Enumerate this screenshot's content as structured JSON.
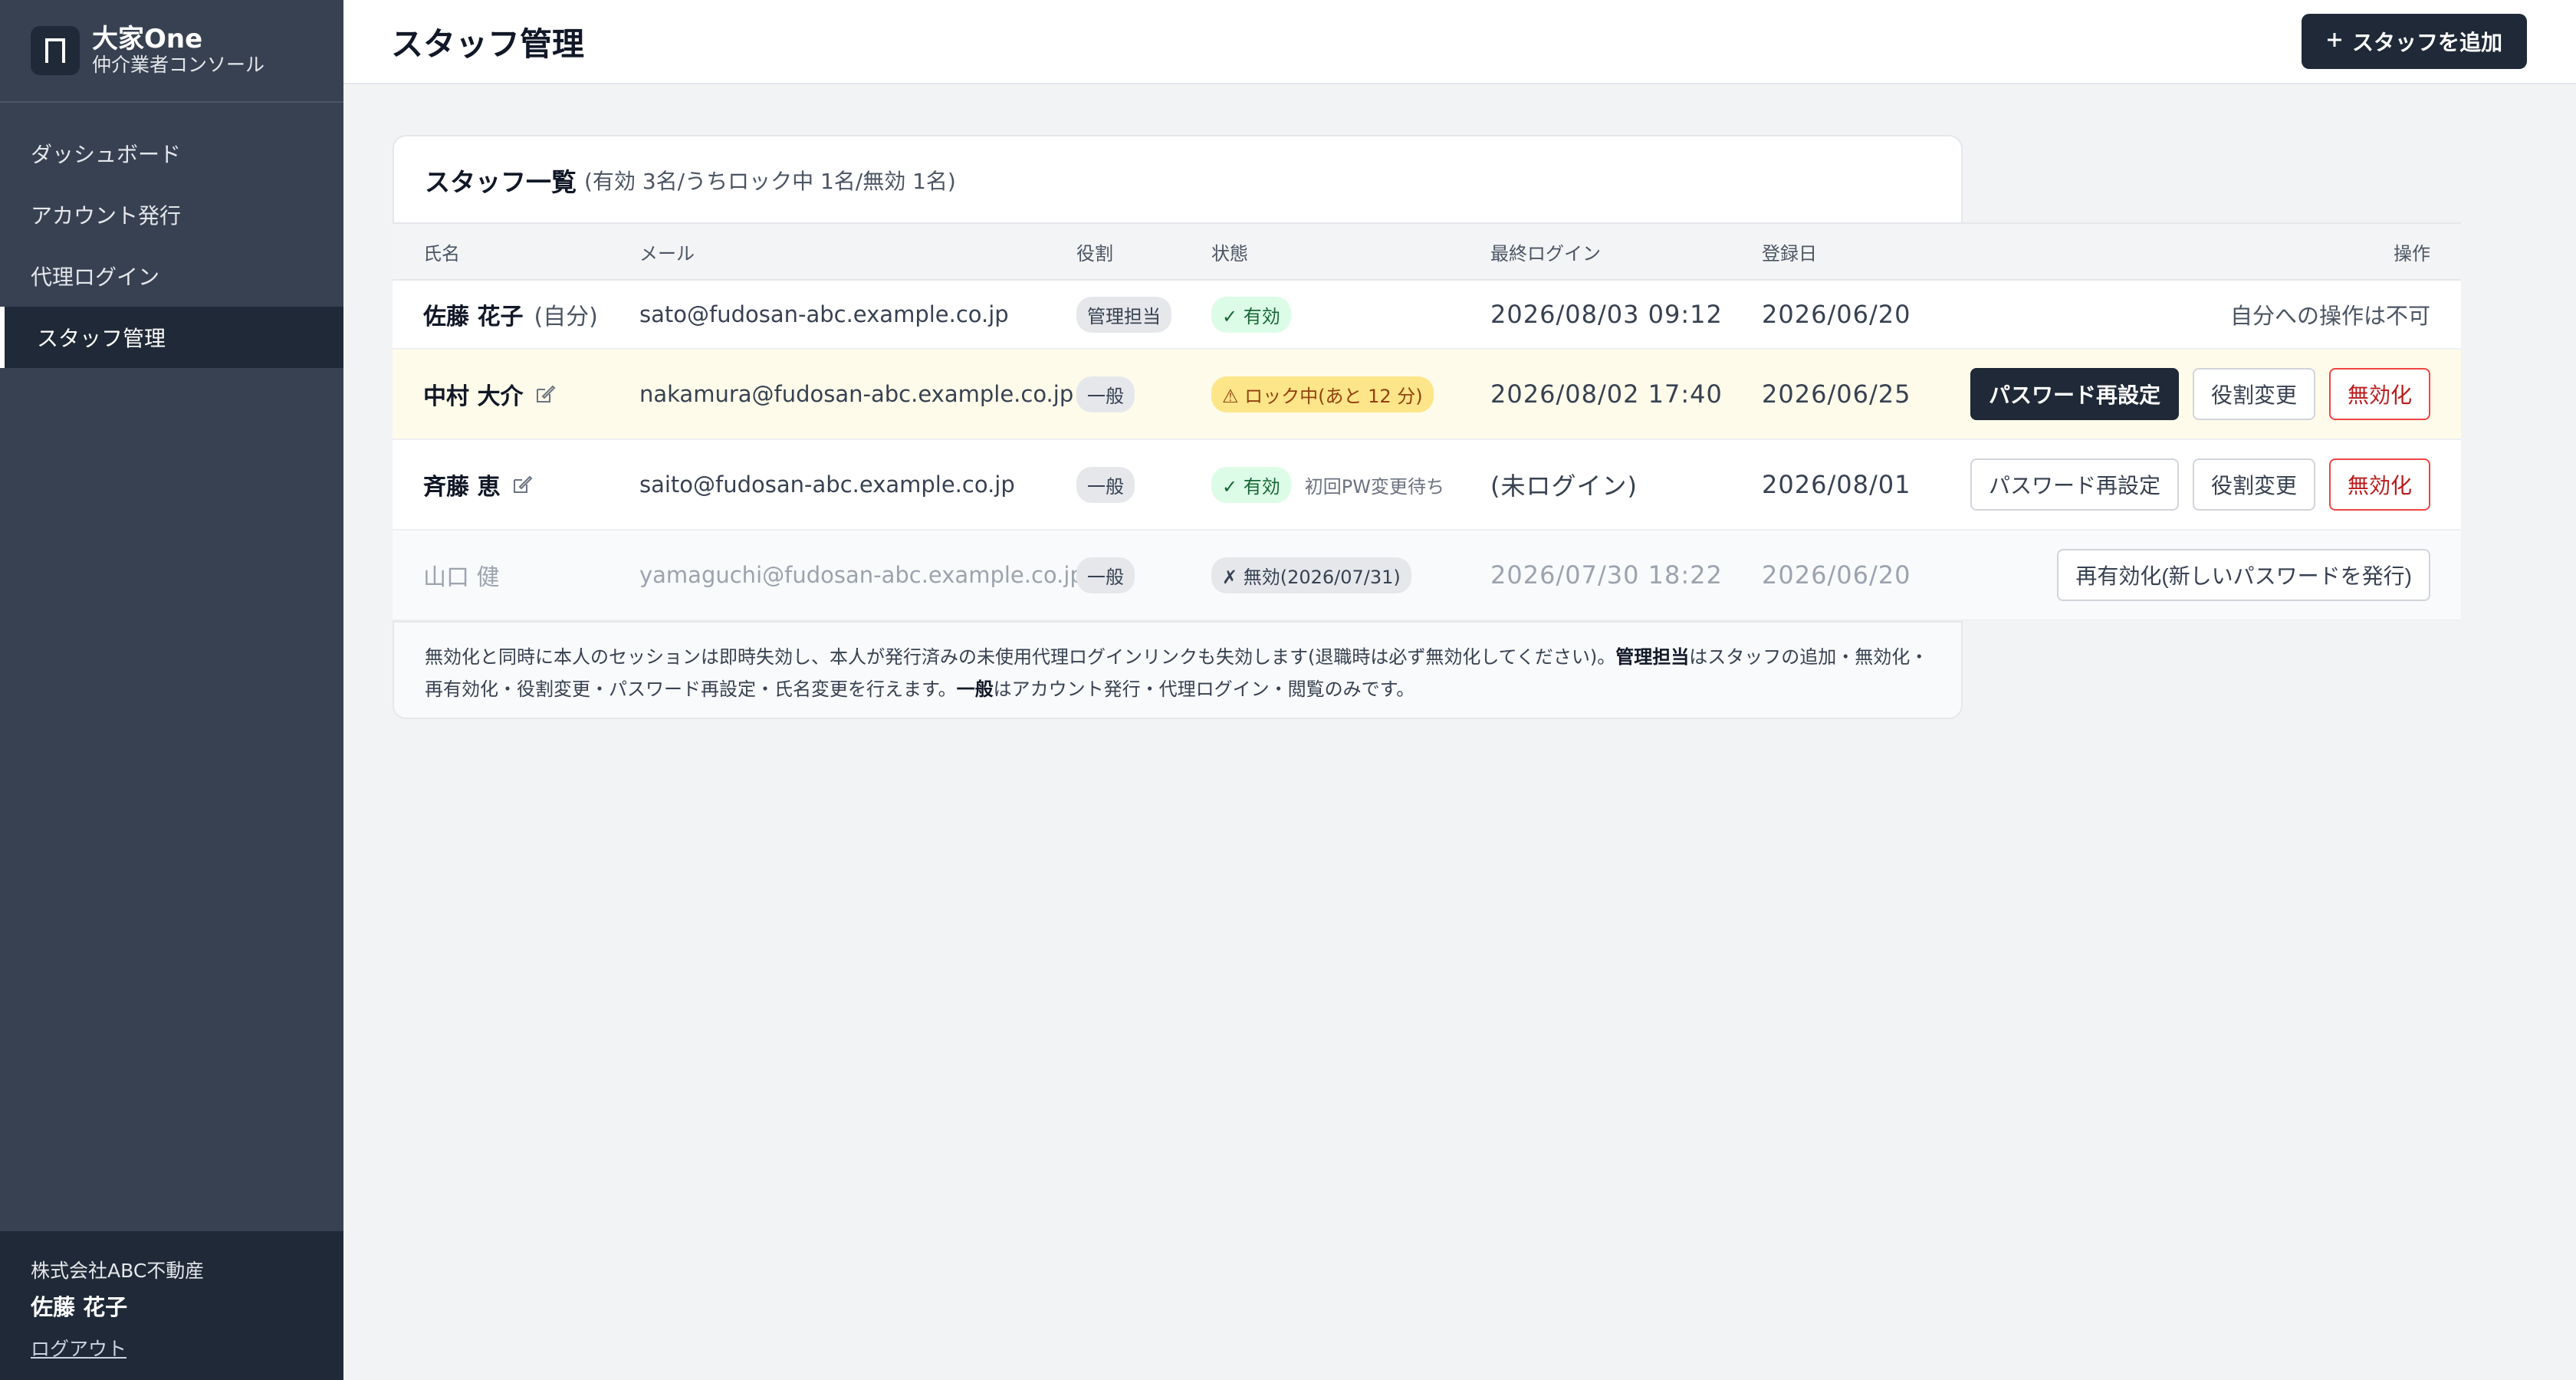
{
  "brand": {
    "name": "大家One",
    "subtitle": "仲介業者コンソール"
  },
  "nav": {
    "items": [
      "ダッシュボード",
      "アカウント発行",
      "代理ログイン",
      "スタッフ管理"
    ],
    "active": "スタッフ管理"
  },
  "footer": {
    "company": "株式会社ABC不動産",
    "user": "佐藤 花子",
    "logout": "ログアウト"
  },
  "header": {
    "title": "スタッフ管理",
    "add_button": "スタッフを追加",
    "add_icon": "plus-icon"
  },
  "card": {
    "title": "スタッフ一覧",
    "summary": "(有効 3名/うちロック中 1名/無効 1名)",
    "columns": {
      "name": "氏名",
      "mail": "メール",
      "role": "役割",
      "status": "状態",
      "login": "最終ログイン",
      "reg": "登録日",
      "ops": "操作"
    },
    "rows": [
      {
        "name": "佐藤 花子",
        "self": "(自分)",
        "mail": "sato@fudosan-abc.example.co.jp",
        "role": "管理担当",
        "status": "✓ 有効",
        "login": "2026/08/03 09:12",
        "reg": "2026/06/20",
        "ops_text": "自分への操作は不可"
      },
      {
        "name": "中村 大介",
        "mail": "nakamura@fudosan-abc.example.co.jp",
        "role": "一般",
        "status": "⚠ ロック中(あと 12 分)",
        "login": "2026/08/02 17:40",
        "reg": "2026/06/25",
        "btn_reset": "パスワード再設定",
        "btn_role": "役割変更",
        "btn_disable": "無効化"
      },
      {
        "name": "斉藤 恵",
        "mail": "saito@fudosan-abc.example.co.jp",
        "role": "一般",
        "status": "✓ 有効",
        "status_note": "初回PW変更待ち",
        "login": "(未ログイン)",
        "reg": "2026/08/01",
        "btn_reset": "パスワード再設定",
        "btn_role": "役割変更",
        "btn_disable": "無効化"
      },
      {
        "name": "山口 健",
        "mail": "yamaguchi@fudosan-abc.example.co.jp",
        "role": "一般",
        "status": "✗ 無効(2026/07/31)",
        "login": "2026/07/30 18:22",
        "reg": "2026/06/20",
        "btn_reactivate": "再有効化(新しいパスワードを発行)"
      }
    ],
    "note": {
      "part1": "無効化と同時に本人のセッションは即時失効し、本人が発行済みの未使用代理ログインリンクも失効します(退職時は必ず無効化してください)。",
      "bold1": "管理担当",
      "part2": "はスタッフの追加・無効化・再有効化・役割変更・パスワード再設定・氏名変更を行えます。",
      "bold2": "一般",
      "part3": "はアカウント発行・代理ログイン・閲覧のみです。"
    }
  }
}
